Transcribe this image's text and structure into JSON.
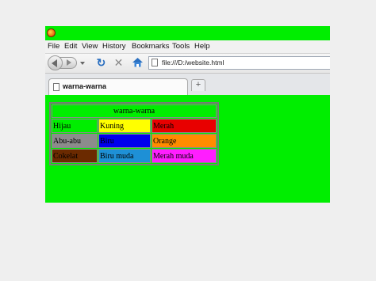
{
  "menu": [
    "File",
    "Edit",
    "View",
    "History",
    "Bookmarks",
    "Tools",
    "Help"
  ],
  "url": "file:///D:/website.html",
  "tab_title": "warna-warna",
  "new_tab_symbol": "+",
  "table": {
    "caption": "warna-warna",
    "rows": [
      [
        {
          "label": "Hijau",
          "color": "#00ee00"
        },
        {
          "label": "Kuning",
          "color": "#ffff00"
        },
        {
          "label": "Merah",
          "color": "#e80000"
        }
      ],
      [
        {
          "label": "Abu-abu",
          "color": "#8c8c8c"
        },
        {
          "label": "Biru",
          "color": "#0000ee"
        },
        {
          "label": "Orange",
          "color": "#ff8c00"
        }
      ],
      [
        {
          "label": "Cokelat",
          "color": "#6b2a00"
        },
        {
          "label": "Biru muda",
          "color": "#1e90d6"
        },
        {
          "label": "Merah muda",
          "color": "#ff1eff"
        }
      ]
    ]
  }
}
